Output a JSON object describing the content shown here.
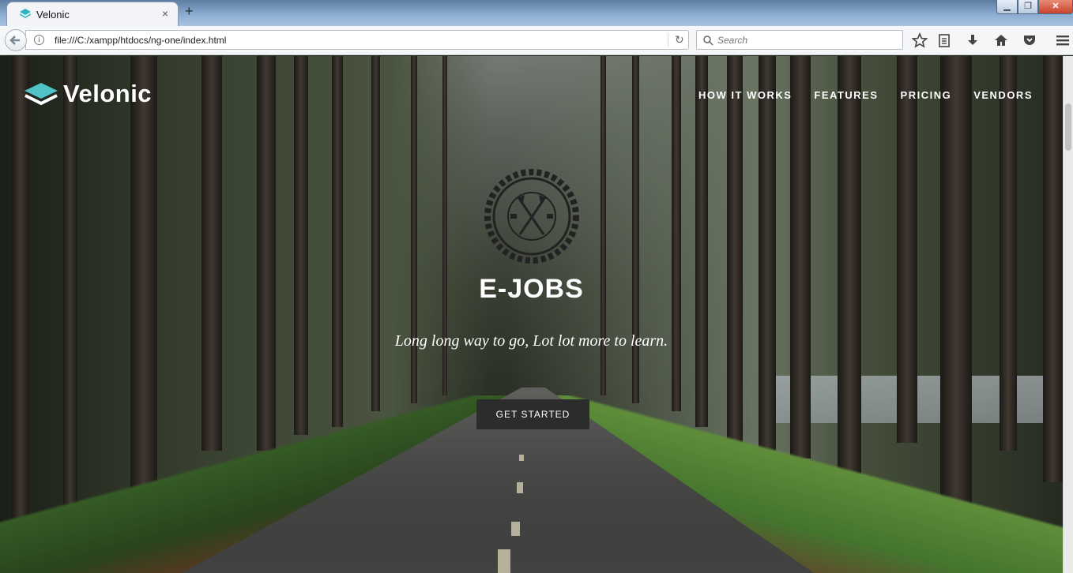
{
  "browser": {
    "tab_title": "Velonic",
    "tab_close": "×",
    "new_tab": "+",
    "url": "file:///C:/xampp/htdocs/ng-one/index.html",
    "search_placeholder": "Search",
    "window_controls": {
      "minimize": "▁",
      "maximize": "❐",
      "close": "✕"
    },
    "toolbar_icons": [
      "bookmark-star-icon",
      "reading-list-icon",
      "downloads-icon",
      "home-icon",
      "pocket-icon",
      "menu-icon"
    ]
  },
  "site": {
    "brand": "Velonic",
    "brand_color": "#4fc3c8",
    "nav": [
      "HOW IT WORKS",
      "FEATURES",
      "PRICING",
      "VENDORS"
    ],
    "hero": {
      "title": "E-JOBS",
      "subtitle": "Long long way to go, Lot lot more to learn.",
      "cta": "GET STARTED"
    }
  }
}
